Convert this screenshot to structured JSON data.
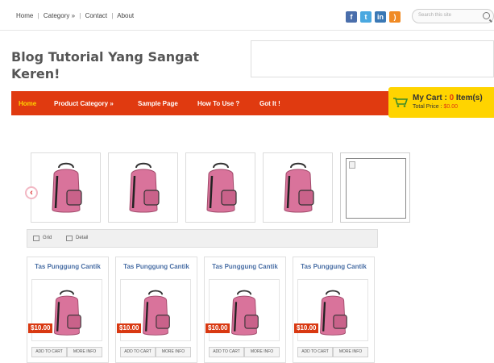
{
  "top_nav": [
    {
      "label": "Home"
    },
    {
      "label": "Category »"
    },
    {
      "label": "Contact"
    },
    {
      "label": "About"
    }
  ],
  "search": {
    "placeholder": "Search this site"
  },
  "site": {
    "title": "Blog Tutorial Yang Sangat Keren!"
  },
  "main_nav": [
    {
      "label": "Home"
    },
    {
      "label": "Product Category »"
    },
    {
      "label": "Sample Page"
    },
    {
      "label": "How To Use ?"
    },
    {
      "label": "Got It !"
    }
  ],
  "cart": {
    "title_prefix": "My Cart : ",
    "count": "0",
    "title_suffix": " Item(s)",
    "price_label": "Total Price : ",
    "price": "$0.00"
  },
  "view": {
    "grid": "Grid",
    "detail": "Detail"
  },
  "products": [
    {
      "title": "Tas Punggung Cantik",
      "price": "$10.00",
      "add": "ADD TO CART",
      "more": "MORE INFO"
    },
    {
      "title": "Tas Punggung Cantik",
      "price": "$10.00",
      "add": "ADD TO CART",
      "more": "MORE INFO"
    },
    {
      "title": "Tas Punggung Cantik",
      "price": "$10.00",
      "add": "ADD TO CART",
      "more": "MORE INFO"
    },
    {
      "title": "Tas Punggung Cantik",
      "price": "$10.00",
      "add": "ADD TO CART",
      "more": "MORE INFO"
    }
  ],
  "colors": {
    "accent": "#e03a10",
    "cart_bg": "#ffd400",
    "bag": "#d9739b",
    "link": "#4a6fa5"
  },
  "icons": [
    "facebook-icon",
    "twitter-icon",
    "linkedin-icon",
    "rss-icon",
    "search-icon",
    "cart-icon",
    "prev-arrow-icon",
    "grid-icon",
    "detail-icon",
    "backpack-icon"
  ]
}
